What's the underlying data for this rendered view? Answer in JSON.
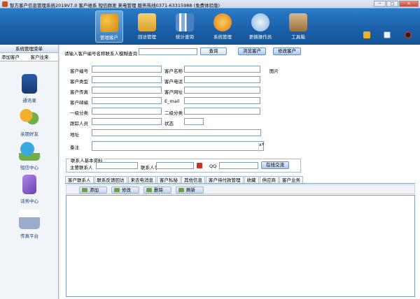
{
  "window": {
    "title": "智方客户信息管理系统2019V7.0 客户维系 短信群发 来电管理 服务热线0371-63315988 (免费体验版)",
    "minimize": "─",
    "maximize": "□",
    "close": "✕"
  },
  "toolbar": {
    "items": [
      {
        "label": "管理客户",
        "color": "#e0a82a"
      },
      {
        "label": "回访管理",
        "color": "#e8b848"
      },
      {
        "label": "统计查询",
        "color": "#7aa8d8"
      },
      {
        "label": "系统管理",
        "color": "#f0a020"
      },
      {
        "label": "更换操作员",
        "color": "#c0d8f0"
      },
      {
        "label": "工具箱",
        "color": "#c0a070"
      }
    ]
  },
  "sidebar": {
    "header": "系统管理菜单",
    "tab_add": "添加客户",
    "tab_contact": "客户往来",
    "items": [
      {
        "label": "通讯录"
      },
      {
        "label": "亲朋好友"
      },
      {
        "label": "短信中心"
      },
      {
        "label": "话务中心"
      },
      {
        "label": "传真平台"
      }
    ]
  },
  "search": {
    "label": "请输入客户编号名称联系人模糊查询",
    "value": "",
    "button": "查询",
    "browse_button": "浏览客户",
    "modify_button": "修改客户"
  },
  "form": {
    "customer_no": "客户编号",
    "customer_name": "客户名称",
    "picture": "图片",
    "customer_type": "客户类型",
    "customer_phone": "客户电话",
    "customer_fax": "客户传真",
    "customer_website": "客户网址",
    "customer_zip": "客户邮编",
    "email": "E_mail",
    "category1": "一级分类",
    "category2": "二级分类",
    "follow_person": "跟踪人员",
    "status": "状态",
    "address": "地址",
    "remark": "备注"
  },
  "contact_group": {
    "title": "联系人基本资料",
    "main_contact": "主要联系人",
    "contact_phone": "联系人手",
    "qq": "QQ",
    "online_chat": "在线交流"
  },
  "tabs": [
    "客户联系人",
    "联系反馈回访",
    "来去电消息",
    "客户私秘",
    "其他信息",
    "客户待付款管理",
    "收藏",
    "供应商",
    "客户业务"
  ],
  "actions": {
    "add": "添加",
    "edit": "修改",
    "delete": "删除",
    "refresh": "刷新"
  }
}
